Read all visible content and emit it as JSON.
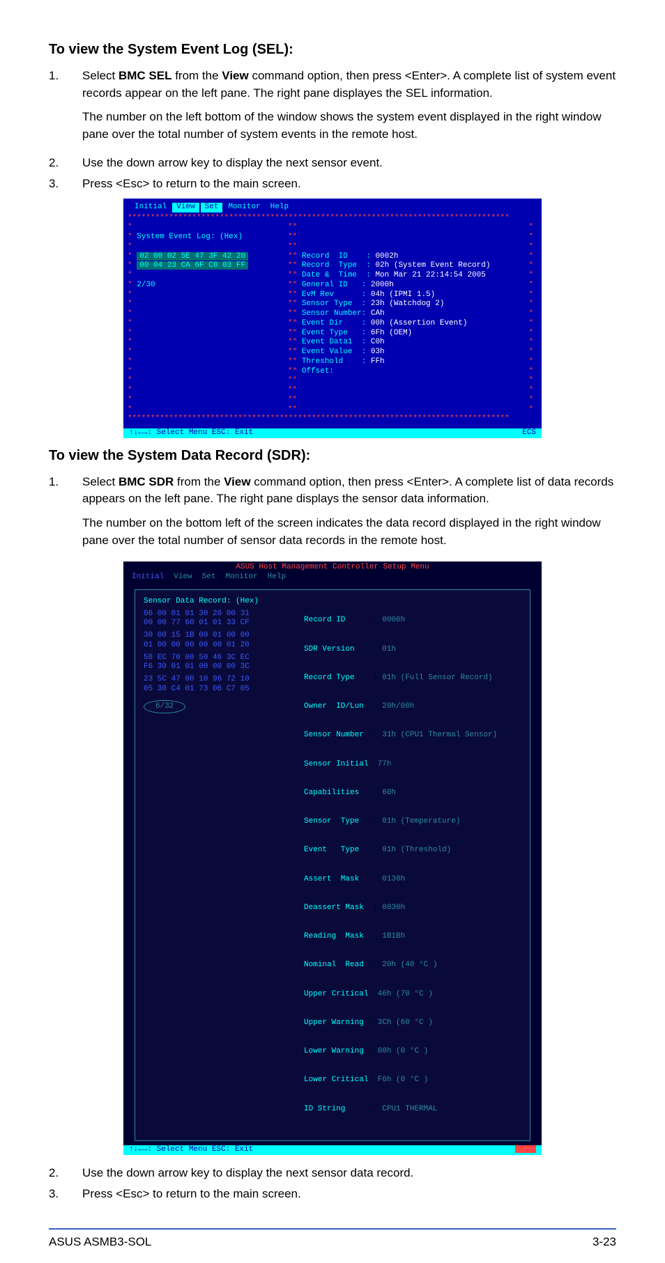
{
  "section1": {
    "heading": "To view the System Event Log (SEL):",
    "steps": [
      "Select <b>BMC SEL</b> from the <b>View</b> command option, then press <Enter>. A complete list of system event records appear on the left pane. The right pane displayes the SEL information.",
      "Use the down arrow key to display the next sensor event.",
      "Press <Esc> to return to the main screen."
    ],
    "sub": "The number on the left bottom of the window shows the system event displayed in the right window pane over the total number of system events in the remote host."
  },
  "shot1": {
    "menu": [
      "Initial",
      "View",
      "Set",
      "Monitor",
      "Help"
    ],
    "left_title": "System Event Log: (Hex)",
    "left_hex": [
      "02 00 02 5E 47 3F 42 20",
      "00 04 23 CA 6F C0 03 FF"
    ],
    "left_count": "2/30",
    "right": [
      {
        "k": "Record  ID",
        "v": "0002h"
      },
      {
        "k": "Record  Type",
        "v": "02h (System Event Record)"
      },
      {
        "k": "Date &  Time",
        "v": "Mon Mar 21 22:14:54 2005"
      },
      {
        "k": "General ID",
        "v": "2000h"
      },
      {
        "k": "EvM Rev",
        "v": "04h (IPMI 1.5)"
      },
      {
        "k": "Sensor Type",
        "v": "23h (Watchdog 2)"
      },
      {
        "k": "Sensor Number",
        "v": "CAh"
      },
      {
        "k": "Event Dir",
        "v": "00h (Assertion Event)"
      },
      {
        "k": "Event Type",
        "v": "6Fh (OEM)"
      },
      {
        "k": "Event Data1",
        "v": "C0h"
      },
      {
        "k": "Event Value",
        "v": "03h"
      },
      {
        "k": "Threshold",
        "v": "FFh"
      },
      {
        "k": "Offset:",
        "v": ""
      }
    ],
    "footer_left": "↑↓←→: Select Menu  ESC: Exit",
    "footer_right": "ECS"
  },
  "section2": {
    "heading": "To view the System Data Record (SDR):",
    "steps": [
      "Select <b>BMC SDR</b> from the <b>View</b> command option, then press <Enter>. A complete list of data records appears on the left pane. The right pane displays the sensor data information.",
      "Use the down arrow key to display the next sensor data record.",
      "Press <Esc> to return to the main screen."
    ],
    "sub": "The number on the bottom left of the screen indicates the data record displayed in the right window pane over the total number of sensor data records in the remote host."
  },
  "shot2": {
    "title": "ASUS Host Management Controller Setup Menu",
    "menu": [
      "Initial",
      "View",
      "Set",
      "Monitor",
      "Help"
    ],
    "left_title": "Sensor Data Record: (Hex)",
    "left_hex": [
      "06 00 01 01 30 20 00 31",
      "00 00 77 60 01 01 33 CF",
      "",
      "30 00 15 1B 00 01 00 00",
      "01 00 00 00 00 00 01 20",
      "",
      "58 EC 70 00 50 46 3C EC",
      "F6 30 01 01 00 00 00 3C",
      "",
      "23 5C 47 00 10 96 72 10",
      "05 30 C4 01 73 06 C7 05"
    ],
    "left_count": "6/32",
    "right": [
      {
        "k": "Record ID",
        "v": "0006h"
      },
      {
        "k": "SDR Version",
        "v": "01h"
      },
      {
        "k": "Record Type",
        "v": "01h (Full Sensor Record)"
      },
      {
        "k": "Owner  ID/Lun",
        "v": "20h/00h"
      },
      {
        "k": "Sensor Number",
        "v": "31h (CPU1 Thermal Sensor)"
      },
      {
        "k": "Sensor Initial",
        "v": "77h"
      },
      {
        "k": "Capabilities",
        "v": "60h"
      },
      {
        "k": "Sensor  Type",
        "v": "01h (Temperature)"
      },
      {
        "k": "Event   Type",
        "v": "01h (Threshold)"
      },
      {
        "k": "Assert  Mask",
        "v": "0130h"
      },
      {
        "k": "Deassert Mask",
        "v": "0030h"
      },
      {
        "k": "Reading  Mask",
        "v": "1B1Bh"
      },
      {
        "k": "Nominal  Read",
        "v": "20h (40 °C )"
      },
      {
        "k": "Upper Critical",
        "v": "46h (70 °C )"
      },
      {
        "k": "Upper Warning",
        "v": "3Ch (60 °C )"
      },
      {
        "k": "Lower Warning",
        "v": "00h (0 °C )"
      },
      {
        "k": "Lower Critical",
        "v": "F6h (0 °C )"
      },
      {
        "k": "ID String",
        "v": "CPU1 THERMAL"
      }
    ],
    "footer": "↑↓←→: Select Menu  ESC: Exit"
  },
  "footer": {
    "left": "ASUS ASMB3-SOL",
    "right": "3-23"
  }
}
